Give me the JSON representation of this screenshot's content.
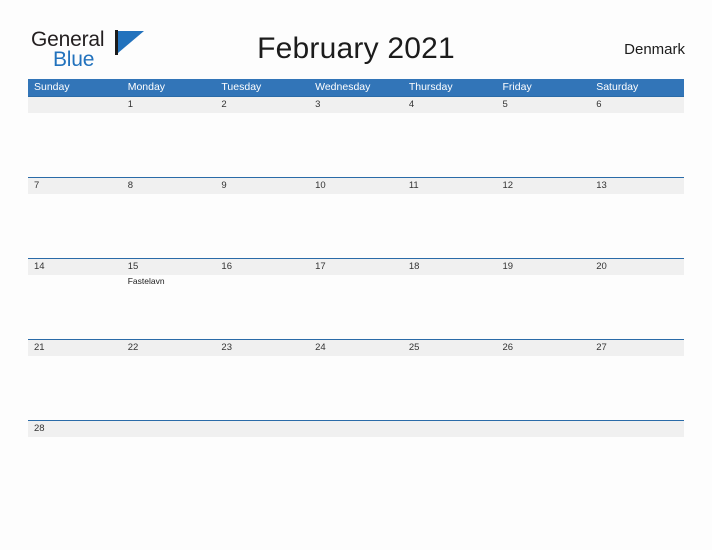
{
  "brand": {
    "name_part1": "General",
    "name_part2": "Blue",
    "logo_icon": "flag-triangle-icon",
    "accent_color": "#2272bd"
  },
  "header": {
    "title": "February 2021",
    "country": "Denmark"
  },
  "colors": {
    "header_blue": "#3275b8",
    "row_divider_blue": "#2a6ba8",
    "date_band_gray": "#f0f0f0",
    "page_background": "#fdfdfd",
    "text_dark": "#333333"
  },
  "calendar": {
    "month": "February",
    "year": "2021",
    "weekday_headers": [
      "Sunday",
      "Monday",
      "Tuesday",
      "Wednesday",
      "Thursday",
      "Friday",
      "Saturday"
    ],
    "weeks": [
      {
        "days": [
          {
            "date": "",
            "event": ""
          },
          {
            "date": "1",
            "event": ""
          },
          {
            "date": "2",
            "event": ""
          },
          {
            "date": "3",
            "event": ""
          },
          {
            "date": "4",
            "event": ""
          },
          {
            "date": "5",
            "event": ""
          },
          {
            "date": "6",
            "event": ""
          }
        ]
      },
      {
        "days": [
          {
            "date": "7",
            "event": ""
          },
          {
            "date": "8",
            "event": ""
          },
          {
            "date": "9",
            "event": ""
          },
          {
            "date": "10",
            "event": ""
          },
          {
            "date": "11",
            "event": ""
          },
          {
            "date": "12",
            "event": ""
          },
          {
            "date": "13",
            "event": ""
          }
        ]
      },
      {
        "days": [
          {
            "date": "14",
            "event": ""
          },
          {
            "date": "15",
            "event": "Fastelavn"
          },
          {
            "date": "16",
            "event": ""
          },
          {
            "date": "17",
            "event": ""
          },
          {
            "date": "18",
            "event": ""
          },
          {
            "date": "19",
            "event": ""
          },
          {
            "date": "20",
            "event": ""
          }
        ]
      },
      {
        "days": [
          {
            "date": "21",
            "event": ""
          },
          {
            "date": "22",
            "event": ""
          },
          {
            "date": "23",
            "event": ""
          },
          {
            "date": "24",
            "event": ""
          },
          {
            "date": "25",
            "event": ""
          },
          {
            "date": "26",
            "event": ""
          },
          {
            "date": "27",
            "event": ""
          }
        ]
      },
      {
        "days": [
          {
            "date": "28",
            "event": ""
          },
          {
            "date": "",
            "event": ""
          },
          {
            "date": "",
            "event": ""
          },
          {
            "date": "",
            "event": ""
          },
          {
            "date": "",
            "event": ""
          },
          {
            "date": "",
            "event": ""
          },
          {
            "date": "",
            "event": ""
          }
        ]
      }
    ]
  }
}
